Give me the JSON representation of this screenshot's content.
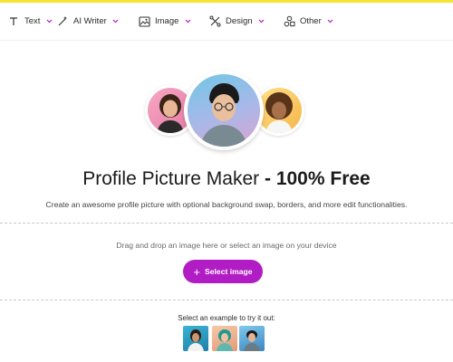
{
  "toolbar": {
    "items": [
      {
        "label": "Text",
        "icon": "text-icon"
      },
      {
        "label": "AI Writer",
        "icon": "ai-writer-icon"
      },
      {
        "label": "Image",
        "icon": "image-icon"
      },
      {
        "label": "Design",
        "icon": "design-icon"
      },
      {
        "label": "Other",
        "icon": "other-icon"
      }
    ],
    "chevron_icon": "chevron-down-icon",
    "accent_color": "#b21cc4"
  },
  "hero": {
    "title_regular": "Profile Picture Maker",
    "title_bold": "- 100% Free",
    "subtitle": "Create an awesome profile picture with optional background swap, borders, and more edit functionalities."
  },
  "upload": {
    "drop_text": "Drag and drop an image here or select an image on your device",
    "button_label": "Select image",
    "button_color": "#b21cc4"
  },
  "examples": {
    "label": "Select an example to try it out:"
  },
  "colors": {
    "top_accent": "#f3e633"
  }
}
